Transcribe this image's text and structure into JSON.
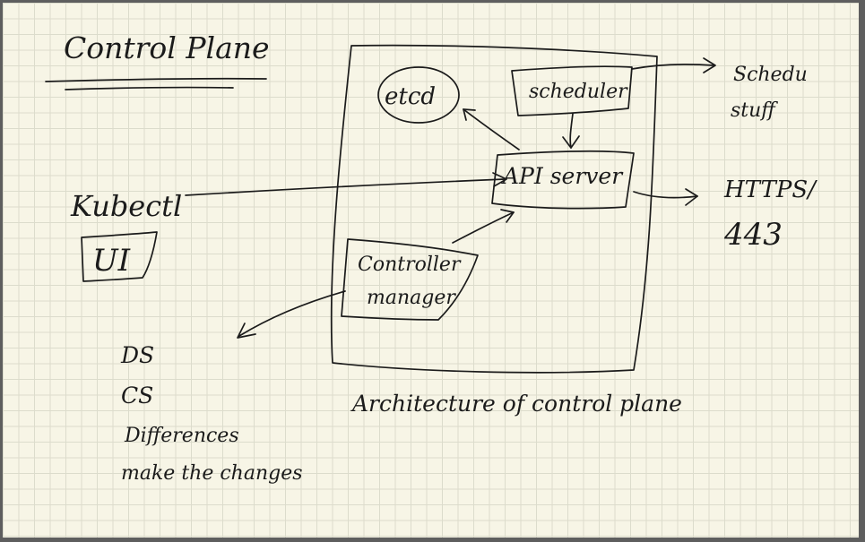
{
  "heading": "Control Plane",
  "components": {
    "etcd": "etcd",
    "scheduler": "scheduler",
    "api_server": "API server",
    "controller_line1": "Controller",
    "controller_line2": "manager",
    "kubectl": "Kubectl",
    "ui": "UI"
  },
  "annotations": {
    "scheduler_line1": "Schedu",
    "scheduler_line2": "stuff",
    "https_line1": "HTTPS/",
    "https_line2": "443",
    "caption": "Architecture of control plane"
  },
  "notes": [
    "DS",
    "CS",
    "Differences",
    "make the changes"
  ]
}
